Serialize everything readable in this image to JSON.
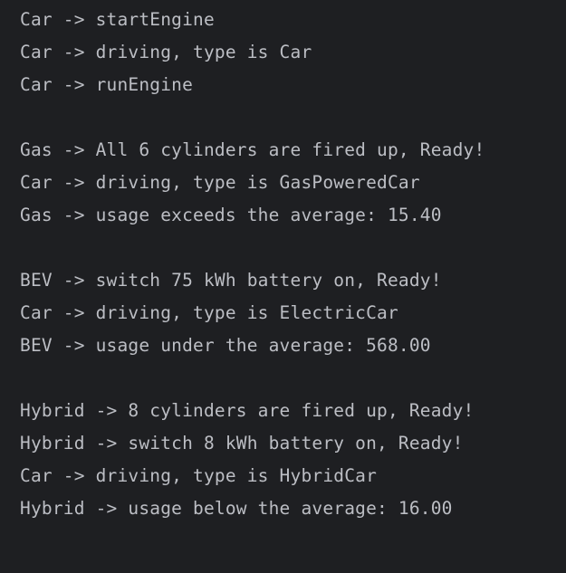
{
  "console": {
    "lines": [
      "Car -> startEngine",
      "Car -> driving, type is Car",
      "Car -> runEngine",
      "",
      "Gas -> All 6 cylinders are fired up, Ready!",
      "Car -> driving, type is GasPoweredCar",
      "Gas -> usage exceeds the average: 15.40",
      "",
      "BEV -> switch 75 kWh battery on, Ready!",
      "Car -> driving, type is ElectricCar",
      "BEV -> usage under the average: 568.00",
      "",
      "Hybrid -> 8 cylinders are fired up, Ready!",
      "Hybrid -> switch 8 kWh battery on, Ready!",
      "Car -> driving, type is HybridCar",
      "Hybrid -> usage below the average: 16.00"
    ],
    "colors": {
      "background": "#1e1f22",
      "text": "#bcbec4"
    }
  }
}
